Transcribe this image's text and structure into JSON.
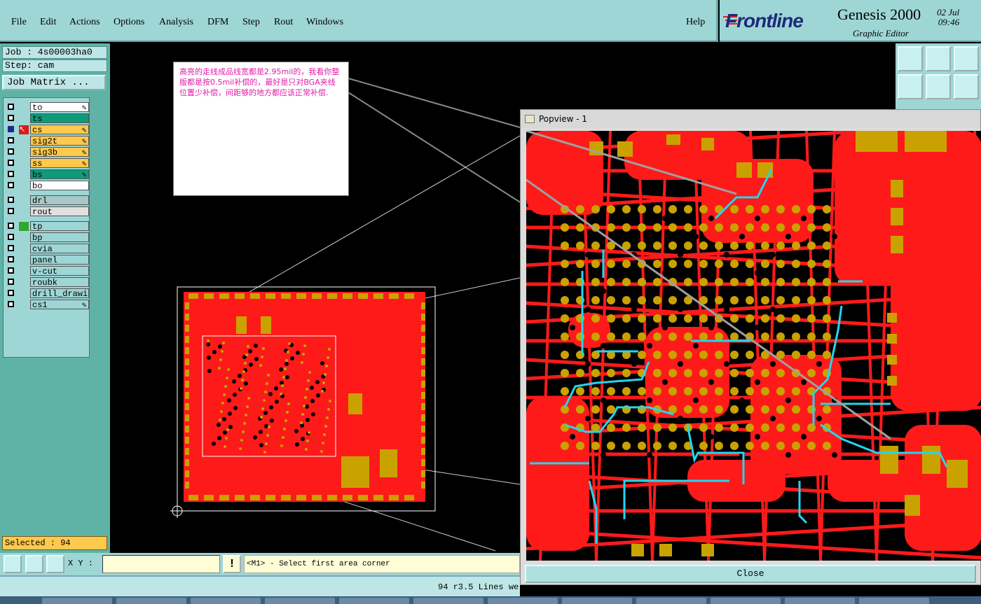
{
  "menu": {
    "items": [
      "File",
      "Edit",
      "Actions",
      "Options",
      "Analysis",
      "DFM",
      "Step",
      "Rout",
      "Windows"
    ],
    "help": "Help"
  },
  "brand": {
    "logo": "Frontline",
    "title": "Genesis 2000",
    "subtitle": "Graphic Editor",
    "date": "02 Jul",
    "time": "09:46"
  },
  "job": {
    "job_line": "Job : 4s00003ha0",
    "step_line": "Step: cam",
    "matrix_button": "Job Matrix ..."
  },
  "layers": [
    {
      "name": "to",
      "color": "#ffffff",
      "affected": true
    },
    {
      "name": "ts",
      "color": "#0f9a7a",
      "affected": false
    },
    {
      "name": "cs",
      "color": "#ffc94d",
      "affected": true,
      "active": true
    },
    {
      "name": "sig2t",
      "color": "#ffc94d",
      "affected": true
    },
    {
      "name": "sig3b",
      "color": "#ffc94d",
      "affected": true
    },
    {
      "name": "ss",
      "color": "#ffc94d",
      "affected": true
    },
    {
      "name": "bs",
      "color": "#0f9a7a",
      "affected": true
    },
    {
      "name": "bo",
      "color": "#ffffff",
      "affected": false
    },
    {
      "name": "drl",
      "color": "#a8c8c8",
      "affected": false
    },
    {
      "name": "rout",
      "color": "#e0e0e0",
      "affected": false
    },
    {
      "name": "tp",
      "color": "#9ed6d6",
      "affected": false,
      "green": true
    },
    {
      "name": "bp",
      "color": "#9ed6d6",
      "affected": false
    },
    {
      "name": "cvia",
      "color": "#9ed6d6",
      "affected": false
    },
    {
      "name": "panel",
      "color": "#9ed6d6",
      "affected": false
    },
    {
      "name": "v-cut",
      "color": "#9ed6d6",
      "affected": false
    },
    {
      "name": "roubk",
      "color": "#9ed6d6",
      "affected": false
    },
    {
      "name": "drill_drawing",
      "color": "#9ed6d6",
      "affected": false
    },
    {
      "name": "cs1",
      "color": "#9ed6d6",
      "affected": true
    }
  ],
  "selected": "Selected : 94",
  "note_text": "高亮的走线成品线宽都是2.95mil的，我看你整版都是按0.5mil补偿的，最好是只对BGA夹线位置少补偿，间距够的地方都应该正常补偿.",
  "popview": {
    "title": "Popview - 1",
    "close_label": "Close"
  },
  "bottom": {
    "xy_label": "X Y :",
    "xy_value": "",
    "warn": "!",
    "prompt": "<M1> - Select first area corner",
    "status": "94 r3.5 Lines we"
  },
  "colors": {
    "copper": "#ff1a1a",
    "pad": "#c9a200",
    "highlight": "#22d7ee",
    "panel": "#9ed6d6"
  }
}
